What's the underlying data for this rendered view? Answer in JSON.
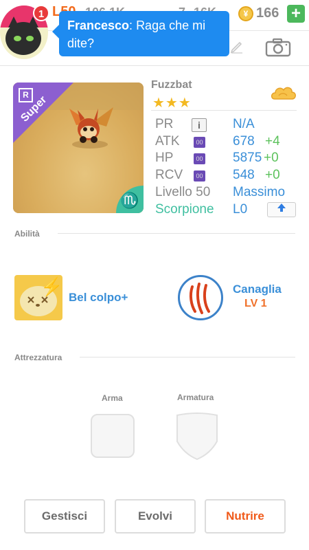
{
  "topbar": {
    "level": "L50",
    "coins": "106.1K",
    "energy": "7",
    "resource2": "16K",
    "gold": "166",
    "add_label": "+"
  },
  "chat": {
    "sender": "Francesco",
    "message": "Raga che mi dite?",
    "badge_count": "1"
  },
  "pet": {
    "name": "Fuzzbat",
    "stars": "★★★",
    "rarity": "R",
    "ribbon": "Super",
    "sign_glyph": "♏",
    "stats": [
      {
        "label": "PR",
        "value": "N/A",
        "plus": ""
      },
      {
        "label": "ATK",
        "value": "678",
        "plus": "+4"
      },
      {
        "label": "HP",
        "value": "5875",
        "plus": "+0"
      },
      {
        "label": "RCV",
        "value": "548",
        "plus": "+0"
      }
    ],
    "level_label": "Livello 50",
    "level_value": "Massimo",
    "zodiac": "Scorpione",
    "zodiac_level": "L0",
    "chip_text": "00"
  },
  "abilities": {
    "title": "Abilità",
    "items": [
      {
        "name": "Bel colpo+",
        "level": ""
      },
      {
        "name": "Canaglia",
        "level": "LV 1"
      }
    ]
  },
  "equipment": {
    "title": "Attrezzatura",
    "weapon_label": "Arma",
    "armor_label": "Armatura"
  },
  "buttons": {
    "manage": "Gestisci",
    "evolve": "Evolvi",
    "feed": "Nutrire"
  },
  "colors": {
    "accent_blue": "#3a8fd8",
    "accent_orange": "#f05a1a",
    "green": "#5cc25c",
    "chat_blue": "#1e8bf0"
  }
}
